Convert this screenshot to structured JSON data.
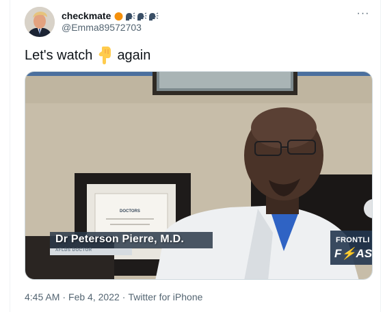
{
  "tweet": {
    "author": {
      "display_name": "checkmate",
      "handle": "@Emma89572703",
      "badge_emojis": [
        "orange-circle-icon",
        "speaking-head-icon",
        "speaking-head-icon",
        "speaking-head-icon"
      ]
    },
    "text_before": "Let's watch",
    "text_emoji": "backhand-index-pointing-down-icon",
    "text_after": "again",
    "media": {
      "type": "video",
      "overlay_name": "Dr Peterson Pierre, M.D.",
      "overlay_subtitle": "AFLDS DOCTOR",
      "logo_line1": "FRONTLI",
      "logo_line2": "F⚡AS",
      "wall_sign": "DOCTORS"
    },
    "time": "4:45 AM",
    "date": "Feb 4, 2022",
    "source": "Twitter for iPhone",
    "separator": "·",
    "more_label": "···"
  }
}
